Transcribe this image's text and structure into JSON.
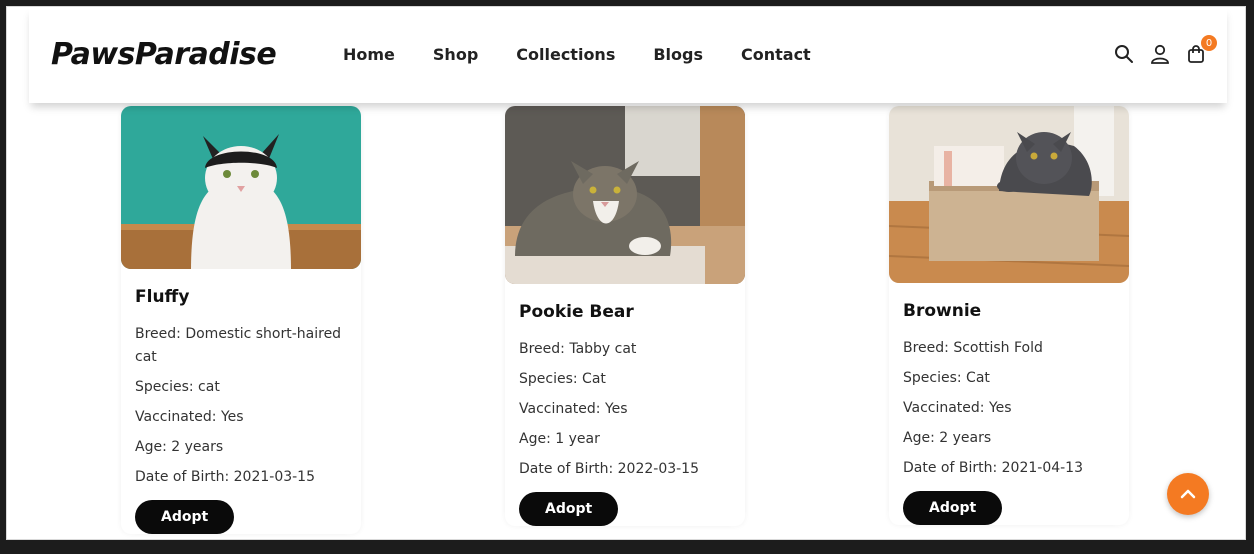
{
  "header": {
    "logo": "PawsParadise",
    "nav": [
      "Home",
      "Shop",
      "Collections",
      "Blogs",
      "Contact"
    ],
    "cart_count": "0"
  },
  "pets": [
    {
      "name": "Fluffy",
      "breed": "Breed: Domestic short-haired cat",
      "species": "Species: cat",
      "vaccinated": "Vaccinated: Yes",
      "age": "Age: 2 years",
      "dob": "Date of Birth: 2021-03-15",
      "button": "Adopt"
    },
    {
      "name": "Pookie Bear",
      "breed": "Breed: Tabby cat",
      "species": "Species: Cat",
      "vaccinated": "Vaccinated: Yes",
      "age": "Age: 1 year",
      "dob": "Date of Birth: 2022-03-15",
      "button": "Adopt"
    },
    {
      "name": "Brownie",
      "breed": "Breed: Scottish Fold",
      "species": "Species: Cat",
      "vaccinated": "Vaccinated: Yes",
      "age": "Age: 2 years",
      "dob": "Date of Birth: 2021-04-13",
      "button": "Adopt"
    }
  ],
  "colors": {
    "accent": "#f47a22",
    "button": "#0a0a0a"
  }
}
